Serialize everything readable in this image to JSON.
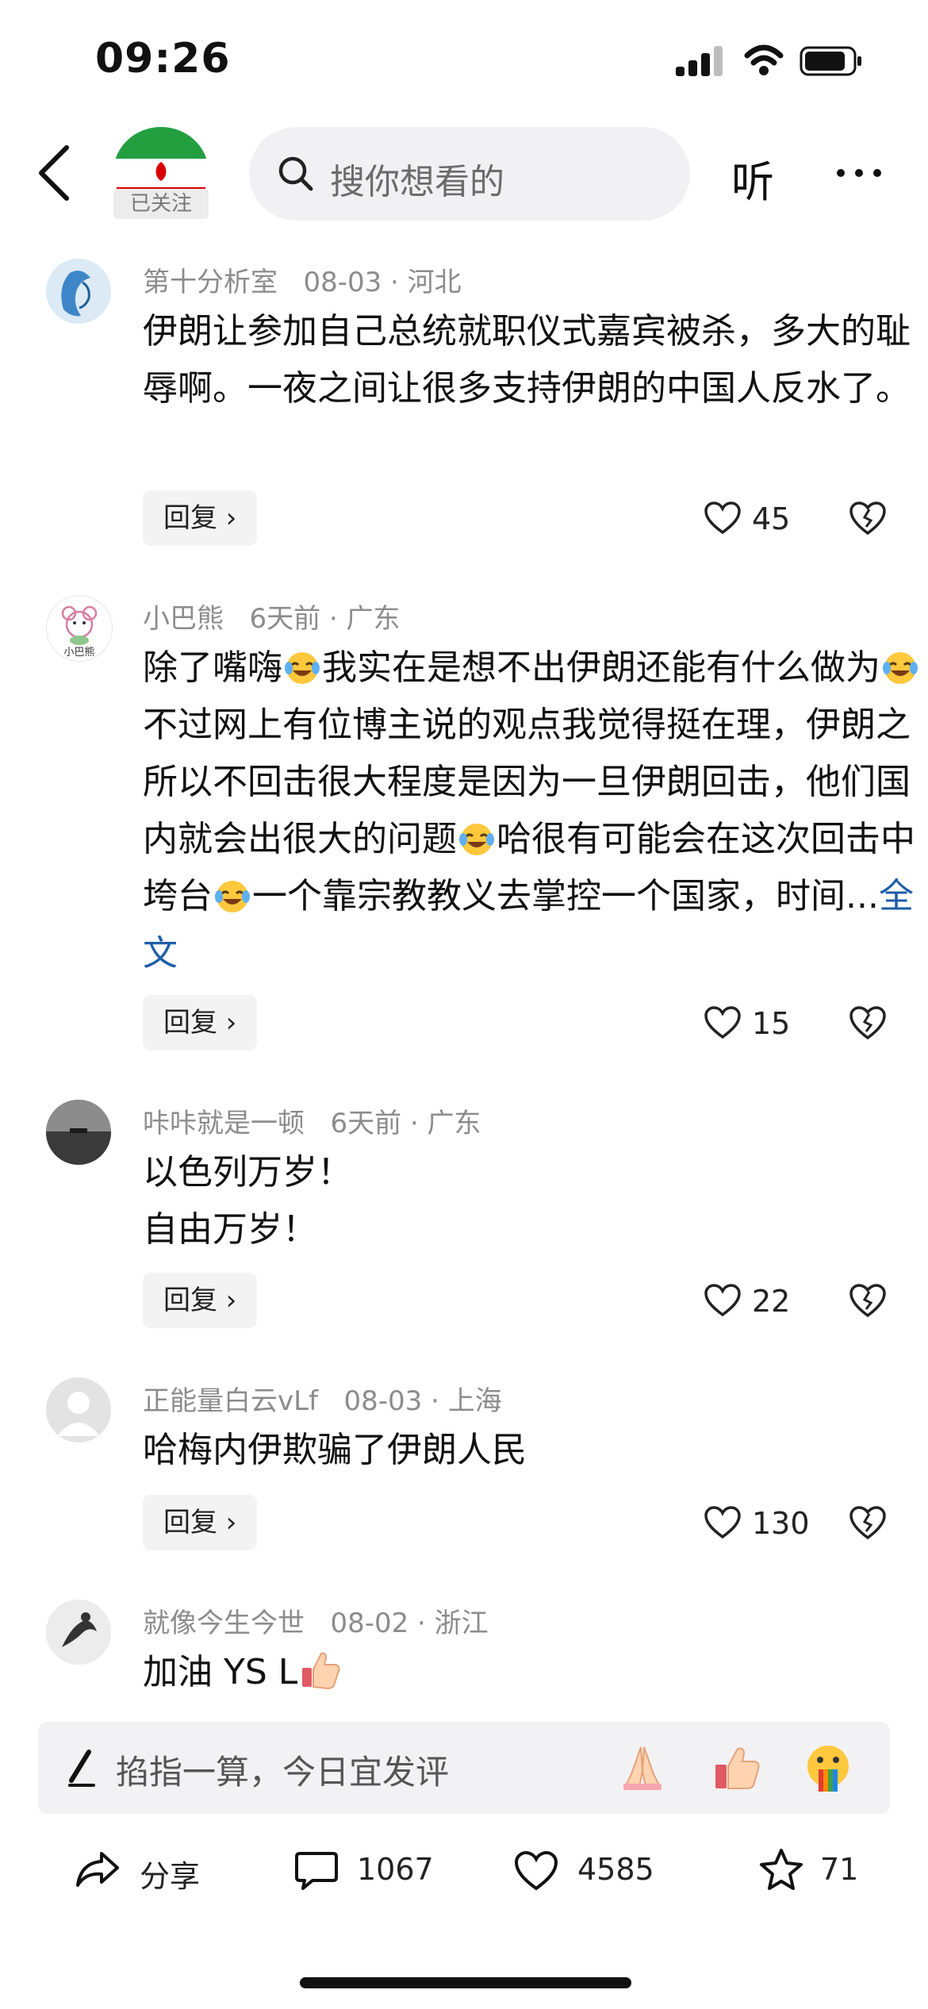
{
  "status_bar": {
    "time": "09:26"
  },
  "header": {
    "follow_label": "已关注",
    "search_placeholder": "搜你想看的",
    "listen_label": "听"
  },
  "comments": [
    {
      "user": "第十分析室",
      "date": "08-03",
      "location": "河北",
      "text": "伊朗让参加自己总统就职仪式嘉宾被杀，多大的耻辱啊。一夜之间让很多支持伊朗的中国人反水了。",
      "reply_label": "回复",
      "likes": "45"
    },
    {
      "user": "小巴熊",
      "date": "6天前",
      "location": "广东",
      "text_part1": "除了嘴嗨",
      "text_part2": "我实在是想不出伊朗还能有什么做为",
      "text_part3": "不过网上有位博主说的观点我觉得挺在理，伊朗之所以不回击很大程度是因为一旦伊朗回击，他们国内就会出很大的问题",
      "text_part4": "哈很有可能会在这次回击中垮台",
      "text_part5": "一个靠宗教教义去掌控一个国家，时间...",
      "full_text_link": "全文",
      "avatar_caption": "小巴熊",
      "reply_label": "回复",
      "likes": "15"
    },
    {
      "user": "咔咔就是一顿",
      "date": "6天前",
      "location": "广东",
      "text_line1": "以色列万岁！",
      "text_line2": "自由万岁！",
      "reply_label": "回复",
      "likes": "22"
    },
    {
      "user": "正能量白云vLf",
      "date": "08-03",
      "location": "上海",
      "text": "哈梅内伊欺骗了伊朗人民",
      "reply_label": "回复",
      "likes": "130"
    },
    {
      "user": "就像今生今世",
      "date": "08-02",
      "location": "浙江",
      "text": "加油 YS L"
    }
  ],
  "composer": {
    "placeholder": "掐指一算，今日宜发评"
  },
  "actions": {
    "share_label": "分享",
    "comments_count": "1067",
    "likes_count": "4585",
    "favorites_count": "71"
  },
  "colors": {
    "link": "#1e5ea8",
    "meta": "#8c8c8c",
    "search_bg": "#f1f1f3"
  }
}
